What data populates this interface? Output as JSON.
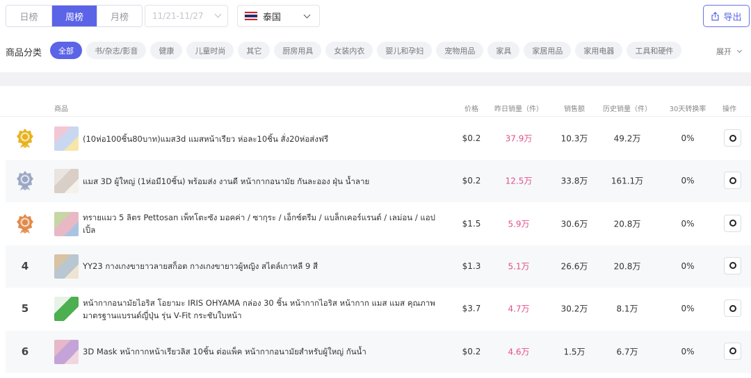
{
  "toolbar": {
    "tabs": [
      {
        "label": "日榜",
        "active": false
      },
      {
        "label": "周榜",
        "active": true
      },
      {
        "label": "月榜",
        "active": false
      }
    ],
    "date_range": "11/21-11/27",
    "country": "泰国",
    "export_label": "导出",
    "accent_color": "#5b63e6"
  },
  "categories": {
    "label": "商品分类",
    "items": [
      "全部",
      "书/杂志/影音",
      "健康",
      "儿童时尚",
      "其它",
      "厨房用具",
      "女装内衣",
      "婴儿和孕妇",
      "宠物用品",
      "家具",
      "家居用品",
      "家用电器",
      "工具和硬件"
    ],
    "active_index": 0,
    "expand_label": "展开"
  },
  "table": {
    "headers": {
      "product": "商品",
      "price": "价格",
      "yesterday_sales": "昨日销量（件）",
      "revenue": "销售额",
      "total_sales": "历史销量（件）",
      "conversion": "30天转换率",
      "action": "操作"
    },
    "rows": [
      {
        "rank": "1",
        "medal": "gold",
        "name": "(10ห่อ100ชิ้น80บาท)แมส3d แมสหน้าเรียว ห่อละ10ชิ้น สั่ง20ห่อส่งฟรี",
        "price": "$0.2",
        "yesterday_sales": "37.9万",
        "revenue": "10.3万",
        "total_sales": "49.2万",
        "conversion": "0%"
      },
      {
        "rank": "2",
        "medal": "silver",
        "name": "แมส 3D ผู้ใหญ่ (1ห่อมี10ชิ้น) พร้อมส่ง งานดี หน้ากากอนามัย กันละออง ฝุ่น น้ำลาย",
        "price": "$0.2",
        "yesterday_sales": "12.5万",
        "revenue": "33.8万",
        "total_sales": "161.1万",
        "conversion": "0%"
      },
      {
        "rank": "3",
        "medal": "bronze",
        "name": "ทรายแมว 5 ลิตร Pettosan เพ็ทโตะซัง มอคค่า / ซากุระ / เอ็กซ์ตรีม / แบล็กเคอร์แรนต์ / เลม่อน / แอปเปิ้ล",
        "price": "$1.5",
        "yesterday_sales": "5.9万",
        "revenue": "30.6万",
        "total_sales": "20.8万",
        "conversion": "0%"
      },
      {
        "rank": "4",
        "medal": "",
        "name": "YY23 กางเกงขายาวลายสก็อต กางเกงขายาวผู้หญิง สไตล์เกาหลี 9 สี",
        "price": "$1.3",
        "yesterday_sales": "5.1万",
        "revenue": "26.6万",
        "total_sales": "20.8万",
        "conversion": "0%"
      },
      {
        "rank": "5",
        "medal": "",
        "name": "หน้ากากอนามัยไอริส โอยามะ IRIS OHYAMA กล่อง 30 ชิ้น หน้ากากไอริส หน้ากาก แมส แมส คุณภาพมาตรฐานแบรนด์ญี่ปุ่น รุ่น V-Fit กระชับใบหน้า",
        "price": "$3.7",
        "yesterday_sales": "4.7万",
        "revenue": "30.2万",
        "total_sales": "8.1万",
        "conversion": "0%"
      },
      {
        "rank": "6",
        "medal": "",
        "name": "3D Mask หน้ากากหน้าเรียวลิส 10ชิ้น ต่อแพ็ค หน้ากากอนามัยสำหรับผู้ใหญ่ กันน้ำ",
        "price": "$0.2",
        "yesterday_sales": "4.6万",
        "revenue": "1.5万",
        "total_sales": "6.7万",
        "conversion": "0%"
      }
    ]
  }
}
